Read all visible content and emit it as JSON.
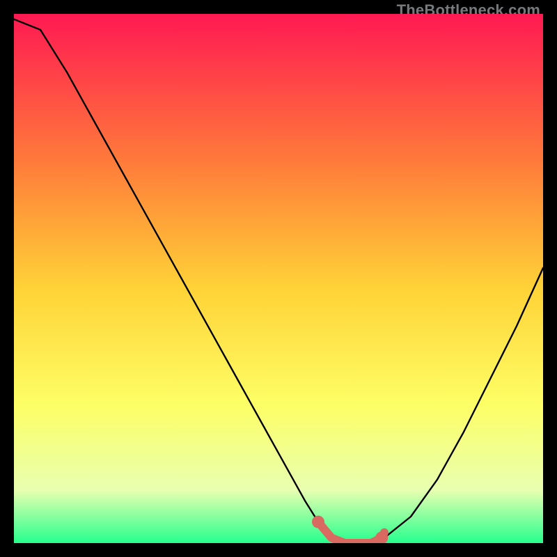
{
  "watermark": "TheBottleneck.com",
  "colors": {
    "gradient_top": "#ff1952",
    "gradient_mid1": "#ff7b3a",
    "gradient_mid2": "#ffd337",
    "gradient_mid3": "#fdff66",
    "gradient_bottom1": "#e8ffb0",
    "gradient_bottom2": "#26ff8e",
    "curve": "#000000",
    "accent": "#d96a61",
    "frame": "#000000"
  },
  "chart_data": {
    "type": "line",
    "title": "",
    "xlabel": "",
    "ylabel": "",
    "x": [
      0.0,
      0.05,
      0.1,
      0.15,
      0.2,
      0.25,
      0.3,
      0.35,
      0.4,
      0.45,
      0.5,
      0.55,
      0.575,
      0.6,
      0.625,
      0.65,
      0.675,
      0.7,
      0.75,
      0.8,
      0.85,
      0.9,
      0.95,
      1.0
    ],
    "values": [
      99,
      97,
      89,
      80,
      71,
      62,
      53,
      44,
      35,
      26,
      17,
      8,
      4,
      1,
      0,
      0,
      0,
      1,
      5,
      12,
      21,
      31,
      41,
      52
    ],
    "ylim": [
      0,
      100
    ],
    "xlim": [
      0,
      1
    ],
    "accent_segment_x": [
      0.575,
      0.6,
      0.625,
      0.65,
      0.675,
      0.695,
      0.7
    ],
    "accent_segment_y": [
      4,
      1,
      0,
      0,
      0,
      1,
      2
    ],
    "accent_dots_x": [
      0.575,
      0.695
    ],
    "accent_dots_y": [
      4,
      1
    ]
  }
}
